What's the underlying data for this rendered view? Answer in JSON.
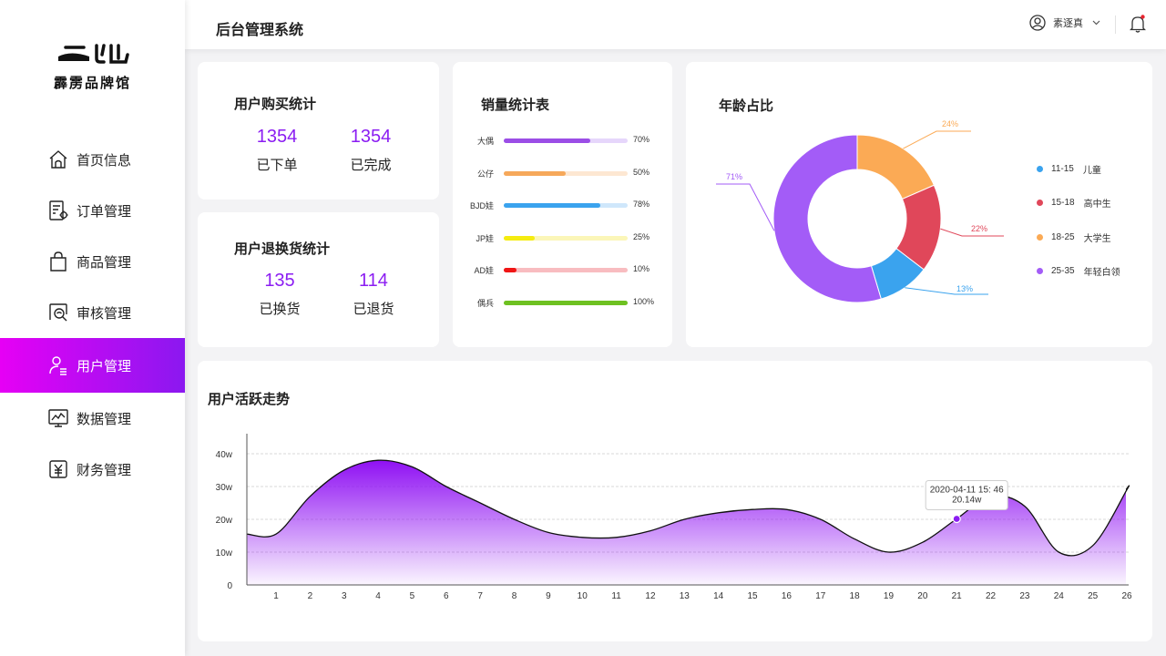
{
  "brand": {
    "name": "霹雳品牌馆"
  },
  "header": {
    "title": "后台管理系统",
    "user_name": "素逐真"
  },
  "sidebar": {
    "items": [
      {
        "label": "首页信息",
        "icon": "home-icon",
        "active": false
      },
      {
        "label": "订单管理",
        "icon": "order-icon",
        "active": false
      },
      {
        "label": "商品管理",
        "icon": "shopping-bag-icon",
        "active": false
      },
      {
        "label": "审核管理",
        "icon": "review-icon",
        "active": false
      },
      {
        "label": "用户管理",
        "icon": "user-list-icon",
        "active": true
      },
      {
        "label": "数据管理",
        "icon": "monitor-chart-icon",
        "active": false
      },
      {
        "label": "财务管理",
        "icon": "finance-icon",
        "active": false
      }
    ]
  },
  "purchase_stats": {
    "title": "用户购买统计",
    "items": [
      {
        "value": "1354",
        "label": "已下单"
      },
      {
        "value": "1354",
        "label": "已完成"
      }
    ]
  },
  "return_stats": {
    "title": "用户退换货统计",
    "items": [
      {
        "value": "135",
        "label": "已换货"
      },
      {
        "value": "114",
        "label": "已退货"
      }
    ]
  },
  "sales": {
    "title": "销量统计表",
    "rows": [
      {
        "name": "大偶",
        "percent": 70,
        "label": "70%",
        "color": "#9b4ee6",
        "track": "#e6d6fb"
      },
      {
        "name": "公仔",
        "percent": 50,
        "label": "50%",
        "color": "#f6a85a",
        "track": "#fde7d2"
      },
      {
        "name": "BJD娃",
        "percent": 78,
        "label": "78%",
        "color": "#3aa3ee",
        "track": "#cfe7fb"
      },
      {
        "name": "JP娃",
        "percent": 25,
        "label": "25%",
        "color": "#f5ec10",
        "track": "#fbf6b8"
      },
      {
        "name": "AD娃",
        "percent": 10,
        "label": "10%",
        "color": "#f01515",
        "track": "#f8bcc0"
      },
      {
        "name": "偶兵",
        "percent": 100,
        "label": "100%",
        "color": "#6ec121",
        "track": "#dff0cc"
      }
    ]
  },
  "age": {
    "title": "年龄占比",
    "chart_data": {
      "type": "pie",
      "slices": [
        {
          "range": "11-15",
          "name": "儿童",
          "value": 13,
          "label": "13%",
          "color": "#3aa3ee"
        },
        {
          "range": "15-18",
          "name": "高中生",
          "value": 22,
          "label": "22%",
          "color": "#e0475a"
        },
        {
          "range": "18-25",
          "name": "大学生",
          "value": 24,
          "label": "24%",
          "color": "#fbaa55"
        },
        {
          "range": "25-35",
          "name": "年轻白领",
          "value": 71,
          "label": "71%",
          "color": "#a35cf7"
        }
      ]
    }
  },
  "activity": {
    "title": "用户活跃走势",
    "chart_data": {
      "type": "area",
      "x": [
        "1",
        "2",
        "3",
        "4",
        "5",
        "6",
        "7",
        "8",
        "9",
        "10",
        "11",
        "12",
        "13",
        "14",
        "15",
        "16",
        "17",
        "18",
        "19",
        "20",
        "21",
        "22",
        "23",
        "24",
        "25",
        "26"
      ],
      "y": [
        15.5,
        27,
        35,
        38,
        36,
        30,
        25,
        20,
        16,
        14.5,
        14.5,
        16.5,
        20,
        22,
        23,
        23,
        20,
        14,
        10,
        13,
        20.14,
        27,
        24,
        10,
        12,
        29
      ],
      "y_ticks": [
        "0",
        "10w",
        "20w",
        "30w",
        "40w"
      ],
      "ylim": [
        0,
        40
      ],
      "grid": true,
      "color": "#8f10f3",
      "tooltip": {
        "x": "21",
        "time": "2020-04-11 15: 46",
        "value": "20.14w"
      }
    }
  }
}
